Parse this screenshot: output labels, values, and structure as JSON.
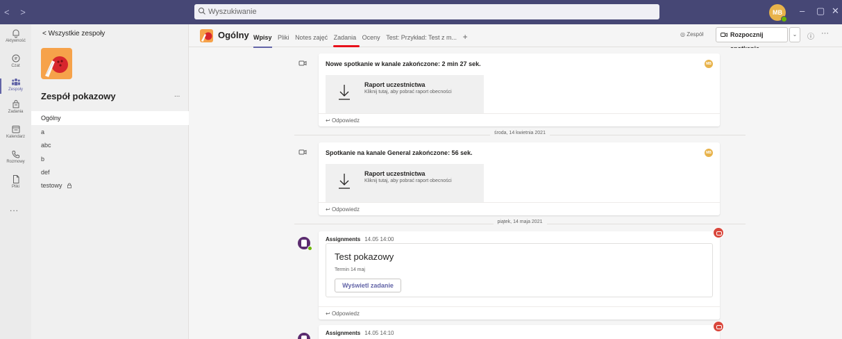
{
  "titlebar": {
    "search_placeholder": "Wyszukiwanie",
    "user_initials": "MB",
    "nav_arrows": "< >"
  },
  "rail": {
    "items": [
      {
        "label": "Aktywność",
        "icon": "bell-icon"
      },
      {
        "label": "Czat",
        "icon": "chat-icon"
      },
      {
        "label": "Zespoły",
        "icon": "teams-icon"
      },
      {
        "label": "Zadania",
        "icon": "assignments-icon"
      },
      {
        "label": "Kalendarz",
        "icon": "calendar-icon"
      },
      {
        "label": "Rozmowy",
        "icon": "phone-icon"
      },
      {
        "label": "Pliki",
        "icon": "file-icon"
      }
    ],
    "more": "..."
  },
  "sidebar": {
    "back_label": "<  Wszystkie zespoły",
    "team_name": "Zespół pokazowy",
    "more": "...",
    "channels": [
      "Ogólny",
      "a",
      "abc",
      "b",
      "def",
      "testowy"
    ]
  },
  "header": {
    "channel_title": "Ogólny",
    "tabs": [
      "Wpisy",
      "Pliki",
      "Notes zajęć",
      "Zadania",
      "Oceny",
      "Test: Przykład: Test z m..."
    ],
    "add_tab": "+",
    "team_label": "Zespół",
    "meet_label": "Rozpocznij spotkanie",
    "dropdown": "⌄",
    "info": "ⓘ",
    "more": "···"
  },
  "feed": {
    "posts": [
      {
        "title": "Nowe spotkanie w kanale zakończone: 2 min 27 sek.",
        "report_title": "Raport uczestnictwa",
        "report_sub": "Kliknij tutaj, aby pobrać raport obecności",
        "reply": "Odpowiedz",
        "avatar": "MB"
      },
      {
        "title": "Spotkanie na kanale General zakończone: 56 sek.",
        "report_title": "Raport uczestnictwa",
        "report_sub": "Kliknij tutaj, aby pobrać raport obecności",
        "reply": "Odpowiedz",
        "avatar": "MB"
      }
    ],
    "date_separators": [
      "środa, 14 kwietnia 2021",
      "piątek, 14 maja 2021"
    ],
    "assignments": [
      {
        "author": "Assignments",
        "time": "14.05 14:00",
        "card_title": "Test pokazowy",
        "due": "Termin 14 maj",
        "button": "Wyświetl zadanie",
        "reply": "Odpowiedz"
      },
      {
        "author": "Assignments",
        "time": "14.05 14:10"
      }
    ]
  },
  "colors": {
    "titlebar": "#464775",
    "accent": "#6264a7",
    "highlight": "#e8101a"
  }
}
